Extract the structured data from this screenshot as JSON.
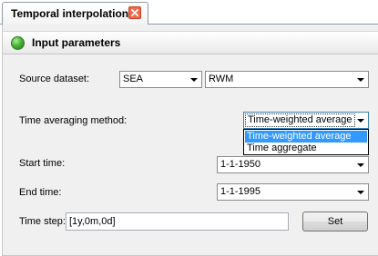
{
  "tab": {
    "title": "Temporal interpolation"
  },
  "section": {
    "title": "Input parameters"
  },
  "form": {
    "source_dataset_label": "Source dataset:",
    "source_dataset_value": "SEA",
    "source_variable_value": "RWM",
    "time_averaging_label": "Time averaging method:",
    "time_averaging_value": "Time-weighted average",
    "time_averaging_options": [
      "Time-weighted average",
      "Time aggregate"
    ],
    "start_time_label": "Start time:",
    "start_time_value": "1-1-1950",
    "end_time_label": "End time:",
    "end_time_value": "1-1-1995",
    "time_step_label": "Time step:",
    "time_step_value": "[1y,0m,0d]",
    "set_button_label": "Set"
  },
  "colors": {
    "close_button": "#f26a48",
    "status_dot": "#4cb43a",
    "selection": "#3399ff",
    "panel_bg": "#f0f0f0"
  }
}
